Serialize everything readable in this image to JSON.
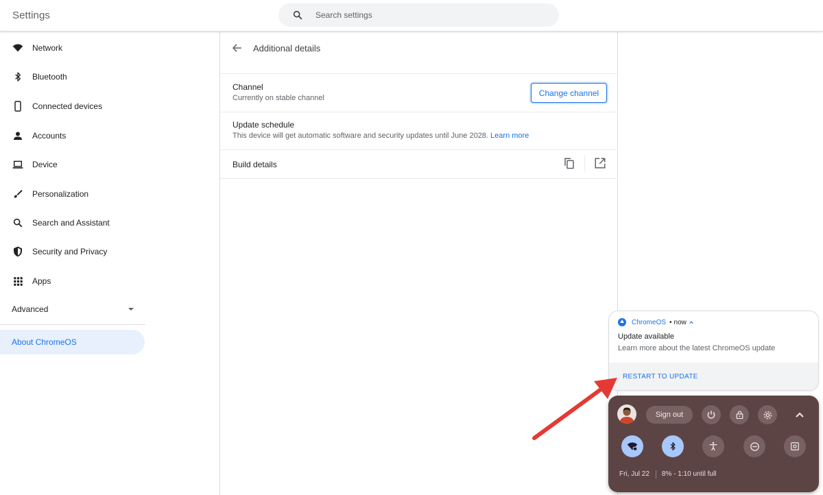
{
  "header": {
    "title": "Settings",
    "search_placeholder": "Search settings"
  },
  "sidebar": {
    "items": [
      {
        "label": "Network",
        "icon": "wifi-icon"
      },
      {
        "label": "Bluetooth",
        "icon": "bluetooth-icon"
      },
      {
        "label": "Connected devices",
        "icon": "phone-icon"
      },
      {
        "label": "Accounts",
        "icon": "person-icon"
      },
      {
        "label": "Device",
        "icon": "laptop-icon"
      },
      {
        "label": "Personalization",
        "icon": "brush-icon"
      },
      {
        "label": "Search and Assistant",
        "icon": "search-icon"
      },
      {
        "label": "Security and Privacy",
        "icon": "shield-icon"
      },
      {
        "label": "Apps",
        "icon": "apps-grid-icon"
      }
    ],
    "advanced_label": "Advanced",
    "about_label": "About ChromeOS"
  },
  "main": {
    "subpage_title": "Additional details",
    "channel": {
      "label": "Channel",
      "value": "Currently on stable channel",
      "button": "Change channel"
    },
    "update_schedule": {
      "label": "Update schedule",
      "text": "This device will get automatic software and security updates until June 2028.",
      "link": "Learn more"
    },
    "build_details": {
      "label": "Build details"
    }
  },
  "notification": {
    "app": "ChromeOS",
    "separator": "•",
    "time": "now",
    "title": "Update available",
    "message": "Learn more about the latest ChromeOS update",
    "action": "RESTART TO UPDATE"
  },
  "tray": {
    "signout": "Sign out",
    "date": "Fri, Jul 22",
    "battery": "8% - 1:10 until full",
    "accent_color": "#a8c7fa",
    "background_color": "#5d4444"
  },
  "colors": {
    "accent": "#1a73e8",
    "annotation_arrow": "#e53935"
  }
}
